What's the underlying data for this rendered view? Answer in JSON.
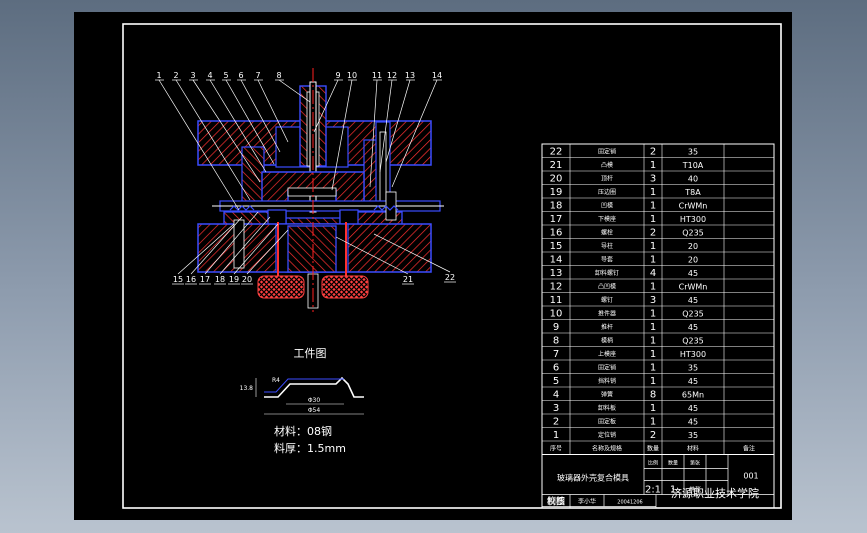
{
  "drawing": {
    "callouts_top": [
      "1",
      "2",
      "3",
      "4",
      "5",
      "6",
      "7",
      "8",
      "9",
      "10",
      "11",
      "12",
      "13",
      "14"
    ],
    "callouts_bottom": [
      "15",
      "16",
      "17",
      "18",
      "19",
      "20"
    ],
    "callout_21": "21",
    "callout_22": "22",
    "workpiece": {
      "title": "工件图",
      "dim_left": "13.8",
      "dim_top_left": "R4",
      "dim_inner": "Φ30",
      "dim_outer": "Φ54",
      "material": "材料：08钢",
      "thickness": "料厚：1.5mm"
    }
  },
  "bom": {
    "rows": [
      {
        "no": "22",
        "name": "固定销",
        "qty": "2",
        "mat": "35"
      },
      {
        "no": "21",
        "name": "凸模",
        "qty": "1",
        "mat": "T10A"
      },
      {
        "no": "20",
        "name": "顶杆",
        "qty": "3",
        "mat": "40"
      },
      {
        "no": "19",
        "name": "压边圈",
        "qty": "1",
        "mat": "T8A"
      },
      {
        "no": "18",
        "name": "凹模",
        "qty": "1",
        "mat": "CrWMn"
      },
      {
        "no": "17",
        "name": "下模座",
        "qty": "1",
        "mat": "HT300"
      },
      {
        "no": "16",
        "name": "螺栓",
        "qty": "2",
        "mat": "Q235"
      },
      {
        "no": "15",
        "name": "导柱",
        "qty": "1",
        "mat": "20"
      },
      {
        "no": "14",
        "name": "导套",
        "qty": "1",
        "mat": "20"
      },
      {
        "no": "13",
        "name": "卸料螺钉",
        "qty": "4",
        "mat": "45"
      },
      {
        "no": "12",
        "name": "凸凹模",
        "qty": "1",
        "mat": "CrWMn"
      },
      {
        "no": "11",
        "name": "螺钉",
        "qty": "3",
        "mat": "45"
      },
      {
        "no": "10",
        "name": "推件器",
        "qty": "1",
        "mat": "Q235"
      },
      {
        "no": "9",
        "name": "推杆",
        "qty": "1",
        "mat": "45"
      },
      {
        "no": "8",
        "name": "模柄",
        "qty": "1",
        "mat": "Q235"
      },
      {
        "no": "7",
        "name": "上模座",
        "qty": "1",
        "mat": "HT300"
      },
      {
        "no": "6",
        "name": "固定销",
        "qty": "1",
        "mat": "35"
      },
      {
        "no": "5",
        "name": "挡料销",
        "qty": "1",
        "mat": "45"
      },
      {
        "no": "4",
        "name": "弹簧",
        "qty": "8",
        "mat": "65Mn"
      },
      {
        "no": "3",
        "name": "卸料板",
        "qty": "1",
        "mat": "45"
      },
      {
        "no": "2",
        "name": "固定板",
        "qty": "1",
        "mat": "45"
      },
      {
        "no": "1",
        "name": "定位销",
        "qty": "2",
        "mat": "35"
      }
    ],
    "header": {
      "no": "序号",
      "name": "名称及规格",
      "qty": "数量",
      "mat": "材料",
      "note": "备注"
    }
  },
  "title_block": {
    "drawing_name": "玻璃器外壳复合模具",
    "scale_label": "比例",
    "count_label": "数量",
    "sheet_label": "第张",
    "scale": "2:1",
    "count": "1",
    "sheet": "共张",
    "drawing_no": "001",
    "drawn_label": "制图",
    "drawn_by": "李小华",
    "date": "20041206",
    "checked_label": "校核",
    "school": "济源职业技术学院"
  },
  "colors": {
    "sheet": "#000000",
    "line": "#ffffff",
    "hatch": "#ff3030",
    "part": "#3b4cff",
    "center": "#ff2020"
  }
}
